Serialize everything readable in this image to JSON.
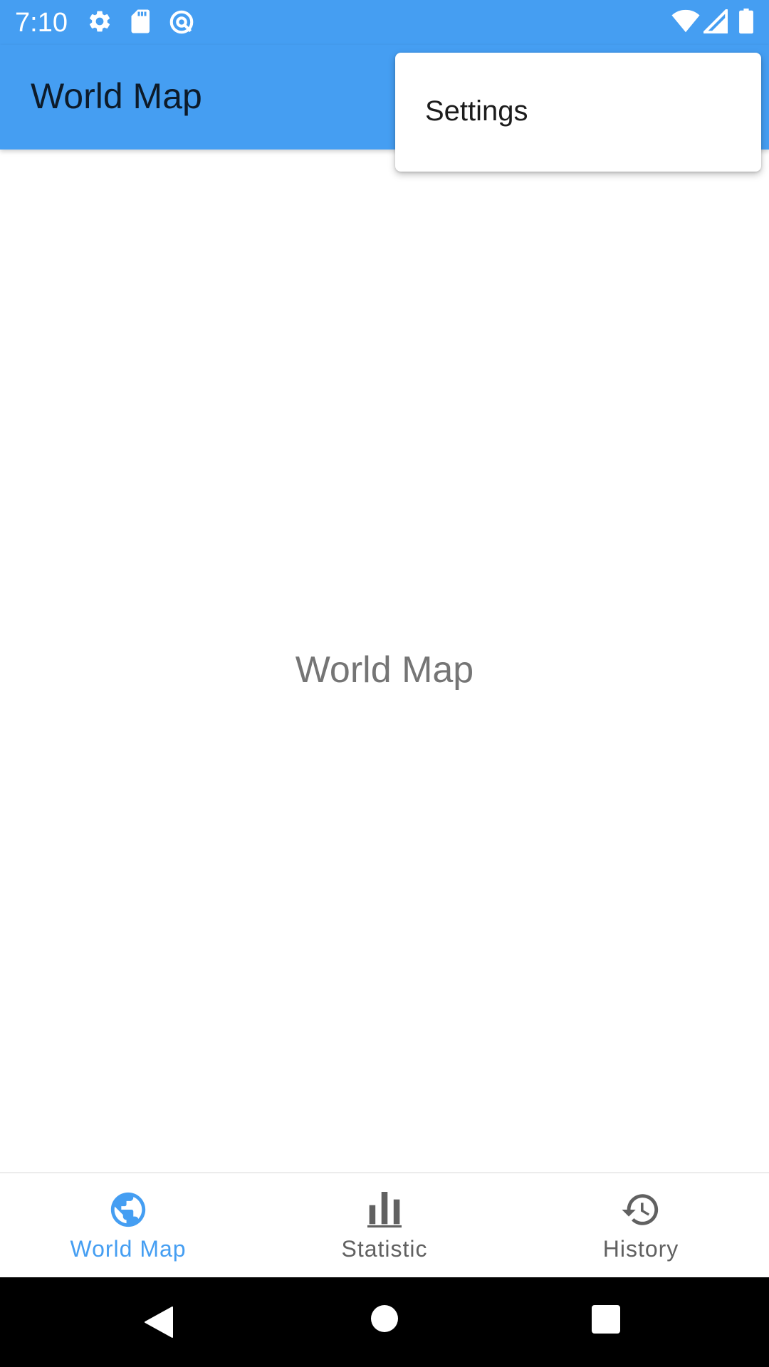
{
  "status_bar": {
    "time": "7:10",
    "left_icons": [
      "gear-icon",
      "sd-card-icon",
      "at-sign-icon"
    ],
    "right_icons": [
      "wifi-icon",
      "signal-icon",
      "battery-icon"
    ]
  },
  "app_bar": {
    "title": "World Map"
  },
  "overflow_menu": {
    "items": [
      {
        "label": "Settings"
      }
    ]
  },
  "main": {
    "placeholder_text": "World Map"
  },
  "bottom_nav": {
    "items": [
      {
        "label": "World Map",
        "icon": "globe-icon",
        "selected": true
      },
      {
        "label": "Statistic",
        "icon": "bar-chart-icon",
        "selected": false
      },
      {
        "label": "History",
        "icon": "history-icon",
        "selected": false
      }
    ]
  },
  "system_nav": {
    "buttons": [
      "back-icon",
      "home-icon",
      "recents-icon"
    ]
  },
  "colors": {
    "primary": "#459ef2",
    "selected_nav": "#459ef2",
    "unselected_nav": "#616161",
    "placeholder_text": "#757575"
  }
}
